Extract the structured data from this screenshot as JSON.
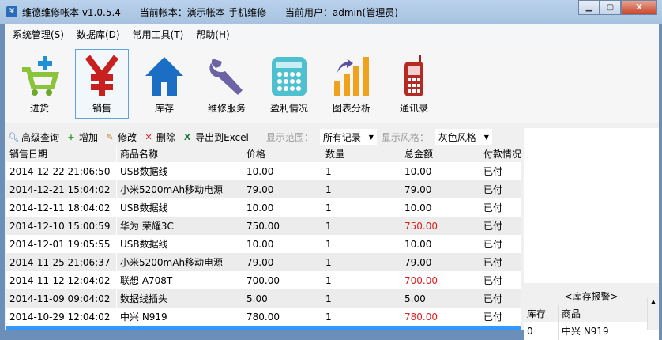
{
  "titlebar": {
    "app": "维德维修帐本  v1.0.5.4",
    "account": "当前帐本：演示帐本-手机维修",
    "user": "当前用户：admin(管理员)",
    "icon": "¥"
  },
  "menu": [
    "系统管理(S)",
    "数据库(D)",
    "常用工具(T)",
    "帮助(H)"
  ],
  "bigbar": [
    "进货",
    "销售",
    "库存",
    "维修服务",
    "盈利情况",
    "图表分析",
    "通讯录"
  ],
  "toolbar": {
    "search": "高级查询",
    "add": "增加",
    "edit": "修改",
    "delete": "删除",
    "export": "导出到Excel",
    "range_label": "显示范围：",
    "range_value": "所有记录",
    "style_label": "显示风格：",
    "style_value": "灰色风格"
  },
  "table": {
    "headers": [
      "销售日期",
      "商品名称",
      "价格",
      "数量",
      "总金额",
      "付款情况"
    ],
    "rows": [
      [
        "2014-12-22 21:06:50",
        "USB数据线",
        "10.00",
        "1",
        "10.00",
        "已付"
      ],
      [
        "2014-12-21 15:04:02",
        "小米5200mAh移动电源",
        "79.00",
        "1",
        "79.00",
        "已付"
      ],
      [
        "2014-12-11 18:04:02",
        "USB数据线",
        "10.00",
        "1",
        "10.00",
        "已付"
      ],
      [
        "2014-12-10 15:00:59",
        "华为 荣耀3C",
        "750.00",
        "1",
        "750.00",
        "已付"
      ],
      [
        "2014-12-01 19:05:55",
        "USB数据线",
        "10.00",
        "1",
        "10.00",
        "已付"
      ],
      [
        "2014-11-25 21:06:37",
        "小米5200mAh移动电源",
        "79.00",
        "1",
        "79.00",
        "已付"
      ],
      [
        "2014-11-12 12:04:02",
        "联想 A708T",
        "700.00",
        "1",
        "700.00",
        "已付"
      ],
      [
        "2014-11-09 09:04:02",
        "数据线插头",
        "5.00",
        "1",
        "5.00",
        "已付"
      ],
      [
        "2014-10-29 12:04:02",
        "中兴 N919",
        "780.00",
        "1",
        "780.00",
        "已付"
      ]
    ],
    "highlight_totals": [
      "750.00",
      "700.00",
      "780.00"
    ]
  },
  "stock_alarm": {
    "title": "<库存报警>",
    "headers": [
      "库存",
      "商品"
    ],
    "rows": [
      [
        "0",
        "中兴 N919"
      ]
    ]
  }
}
